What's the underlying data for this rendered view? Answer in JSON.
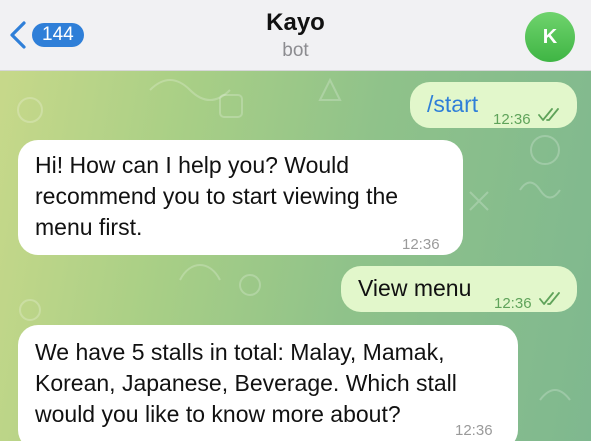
{
  "header": {
    "back_count": "144",
    "title": "Kayo",
    "subtitle": "bot",
    "avatar_initial": "K"
  },
  "colors": {
    "accent": "#2f7fd8",
    "outgoing_bubble": "#e2f7cb",
    "incoming_bubble": "#ffffff",
    "avatar": "#4cbf4f"
  },
  "messages": [
    {
      "direction": "outgoing",
      "lines": [
        "/start"
      ],
      "time": "12:36",
      "status": "read"
    },
    {
      "direction": "incoming",
      "lines": [
        "Hi! How can I help you? Would",
        "recommend you to start viewing the",
        "menu first."
      ],
      "time": "12:36"
    },
    {
      "direction": "outgoing",
      "lines": [
        "View menu"
      ],
      "time": "12:36",
      "status": "read"
    },
    {
      "direction": "incoming",
      "lines": [
        "We have 5 stalls in total: Malay, Mamak,",
        "Korean, Japanese, Beverage. Which stall",
        "would you like to know more about?"
      ],
      "time": "12:36"
    }
  ]
}
